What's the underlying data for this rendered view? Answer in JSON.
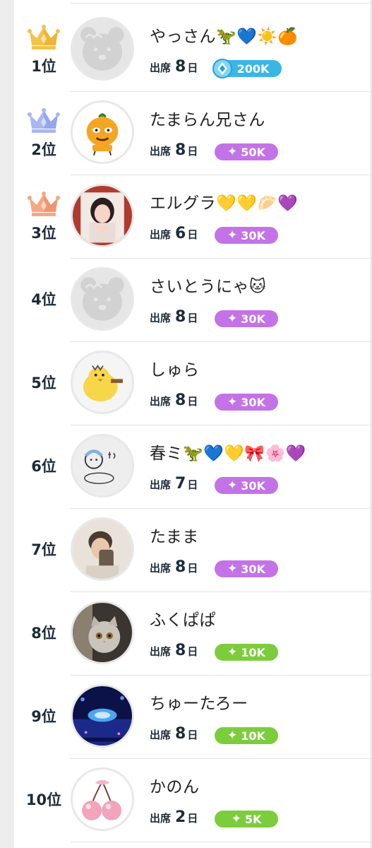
{
  "ranking": {
    "attend_label": "出席",
    "day_unit": "日",
    "entries": [
      {
        "rank": "1位",
        "name": "やっさん🦖💙☀️🍊",
        "days": "8",
        "badge": "200K",
        "badge_type": "diamond",
        "crown": "gold",
        "avatar": "bear-placeholder"
      },
      {
        "rank": "2位",
        "name": "たまらん兄さん",
        "days": "8",
        "badge": "50K",
        "badge_type": "purple",
        "crown": "silver",
        "avatar": "orange-character"
      },
      {
        "rank": "3位",
        "name": "エルグラ💛💛🥟💜",
        "days": "6",
        "badge": "30K",
        "badge_type": "purple",
        "crown": "bronze",
        "avatar": "photo-girl"
      },
      {
        "rank": "4位",
        "name": "さいとうにゃ🐱",
        "days": "8",
        "badge": "30K",
        "badge_type": "purple",
        "crown": "",
        "avatar": "bear-placeholder"
      },
      {
        "rank": "5位",
        "name": "しゅら",
        "days": "8",
        "badge": "30K",
        "badge_type": "purple",
        "crown": "",
        "avatar": "yellow-bird"
      },
      {
        "rank": "6位",
        "name": "春ミ🦖💙💛🎀🌸💜",
        "days": "7",
        "badge": "30K",
        "badge_type": "purple",
        "crown": "",
        "avatar": "sketch-drawing"
      },
      {
        "rank": "7位",
        "name": "たまま",
        "days": "8",
        "badge": "30K",
        "badge_type": "purple",
        "crown": "",
        "avatar": "photo-person"
      },
      {
        "rank": "8位",
        "name": "ふくぱぱ",
        "days": "8",
        "badge": "10K",
        "badge_type": "green",
        "crown": "",
        "avatar": "photo-cat"
      },
      {
        "rank": "9位",
        "name": "ちゅーたろー",
        "days": "8",
        "badge": "10K",
        "badge_type": "green",
        "crown": "",
        "avatar": "photo-stage"
      },
      {
        "rank": "10位",
        "name": "かのん",
        "days": "2",
        "badge": "5K",
        "badge_type": "green",
        "crown": "",
        "avatar": "cherry"
      }
    ]
  },
  "colors": {
    "gold_crown": "#f3c34a",
    "silver_crown": "#a9b8f0",
    "bronze_crown": "#f5a784",
    "diamond_badge": "#3ab6e6",
    "purple_badge": "#c373e6",
    "green_badge": "#7ccd3c"
  }
}
